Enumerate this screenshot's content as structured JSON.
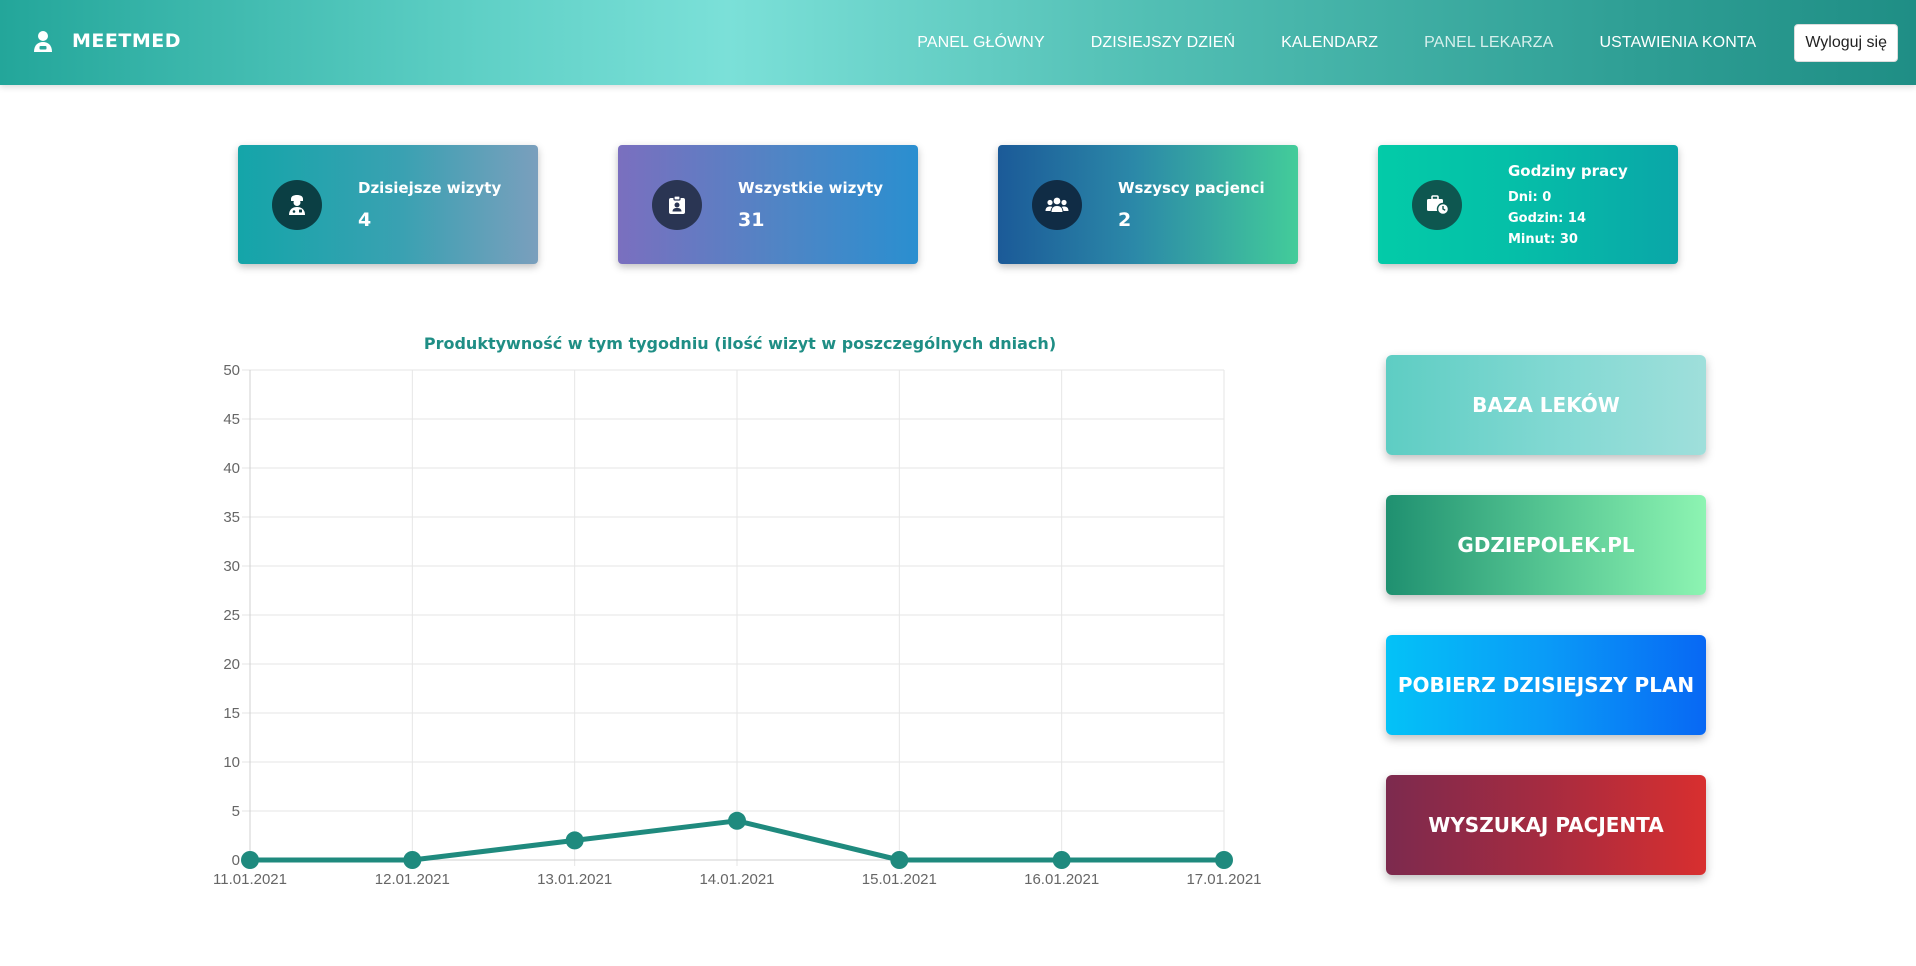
{
  "brand": {
    "name": "MEETMED",
    "icon": "doctor-user-icon"
  },
  "nav": {
    "items": [
      {
        "label": "PANEL GŁÓWNY",
        "active": false
      },
      {
        "label": "DZISIEJSZY DZIEŃ",
        "active": false
      },
      {
        "label": "KALENDARZ",
        "active": false
      },
      {
        "label": "PANEL LEKARZA",
        "active": true
      },
      {
        "label": "USTAWIENIA KONTA",
        "active": false
      }
    ],
    "logout_label": "Wyloguj się"
  },
  "cards": [
    {
      "title": "Dzisiejsze wizyty",
      "value": "4",
      "icon": "doctor-icon"
    },
    {
      "title": "Wszystkie wizyty",
      "value": "31",
      "icon": "id-badge-icon"
    },
    {
      "title": "Wszyscy pacjenci",
      "value": "2",
      "icon": "users-icon"
    },
    {
      "title": "Godziny pracy",
      "lines": [
        "Dni: 0",
        "Godzin: 14",
        "Minut: 30"
      ],
      "icon": "briefcase-clock-icon"
    }
  ],
  "chart_data": {
    "type": "line",
    "title": "Produktywność w tym tygodniu (ilość wizyt w poszczególnych dniach)",
    "categories": [
      "11.01.2021",
      "12.01.2021",
      "13.01.2021",
      "14.01.2021",
      "15.01.2021",
      "16.01.2021",
      "17.01.2021"
    ],
    "values": [
      0,
      0,
      2,
      4,
      0,
      0,
      0
    ],
    "ylim": [
      0,
      50
    ],
    "yticks": [
      0,
      5,
      10,
      15,
      20,
      25,
      30,
      35,
      40,
      45,
      50
    ],
    "grid": true,
    "line_color": "#1f8a7e",
    "xlabel": "",
    "ylabel": ""
  },
  "actions": [
    {
      "label": "BAZA LEKÓW"
    },
    {
      "label": "GDZIEPOLEK.PL"
    },
    {
      "label": "POBIERZ DZISIEJSZY PLAN"
    },
    {
      "label": "WYSZUKAJ PACJENTA"
    }
  ]
}
